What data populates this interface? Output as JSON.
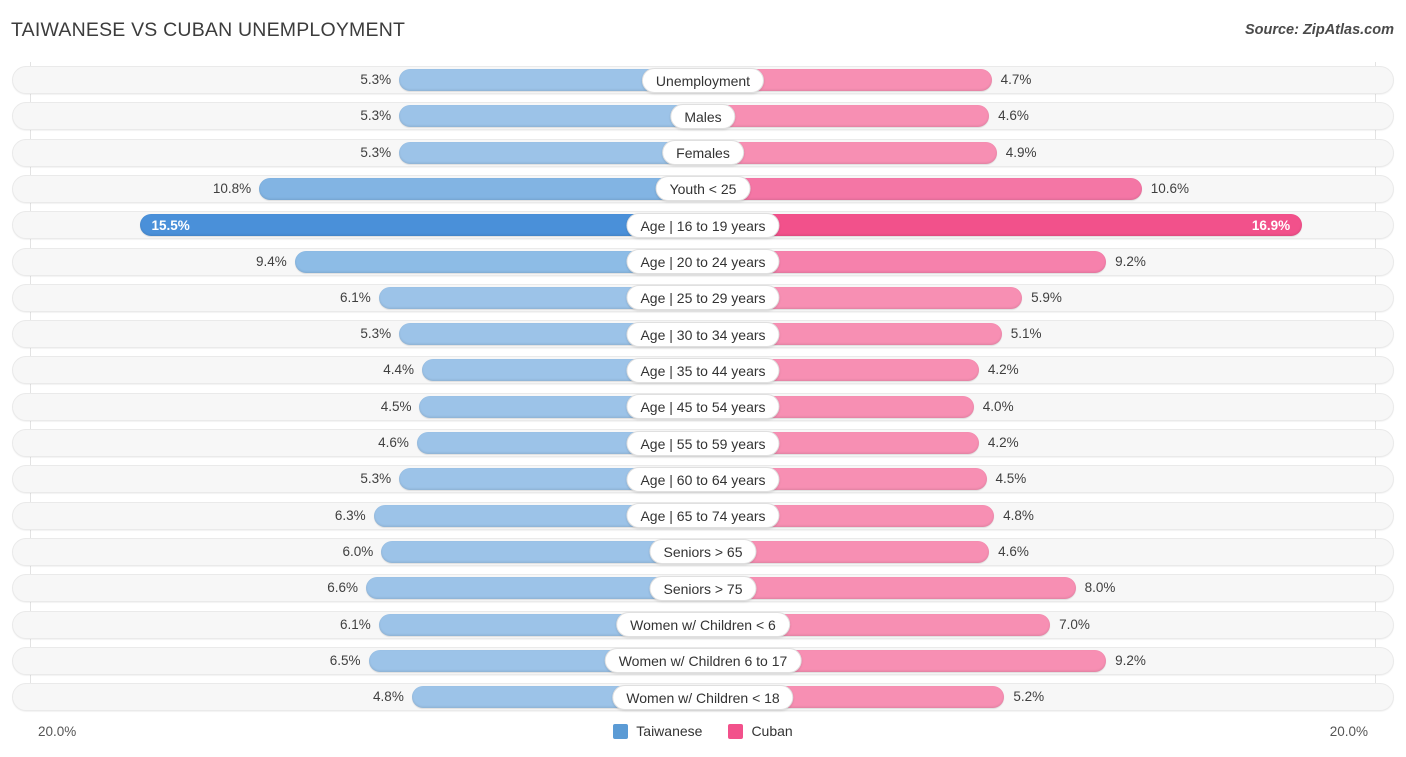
{
  "header": {
    "title": "TAIWANESE VS CUBAN UNEMPLOYMENT",
    "source": "Source: ZipAtlas.com"
  },
  "axis": {
    "left_label": "20.0%",
    "right_label": "20.0%"
  },
  "legend": {
    "items": [
      {
        "label": "Taiwanese",
        "color": "#5b9bd5"
      },
      {
        "label": "Cuban",
        "color": "#f2518b"
      }
    ]
  },
  "colors": {
    "taiwanese": "#9cc3e8",
    "taiwanese_max": "#4a90d9",
    "cuban": "#f78fb3",
    "cuban_max": "#f2518b",
    "track": "#f7f7f7",
    "gridline": "#e3e3e3"
  },
  "chart_data": {
    "type": "bar",
    "title": "TAIWANESE VS CUBAN UNEMPLOYMENT",
    "subtitle": "",
    "xlabel": "",
    "ylabel": "",
    "orientation": "horizontal-diverging",
    "axis_max_percent": 20.0,
    "xlim": [
      20.0,
      20.0
    ],
    "grid": true,
    "legend_position": "bottom-center",
    "categories": [
      "Unemployment",
      "Males",
      "Females",
      "Youth < 25",
      "Age | 16 to 19 years",
      "Age | 20 to 24 years",
      "Age | 25 to 29 years",
      "Age | 30 to 34 years",
      "Age | 35 to 44 years",
      "Age | 45 to 54 years",
      "Age | 55 to 59 years",
      "Age | 60 to 64 years",
      "Age | 65 to 74 years",
      "Seniors > 65",
      "Seniors > 75",
      "Women w/ Children < 6",
      "Women w/ Children 6 to 17",
      "Women w/ Children < 18"
    ],
    "series": [
      {
        "name": "Taiwanese",
        "side": "left",
        "color": "#9cc3e8",
        "values": [
          5.3,
          5.3,
          5.3,
          10.8,
          15.5,
          9.4,
          6.1,
          5.3,
          4.4,
          4.5,
          4.6,
          5.3,
          6.3,
          6.0,
          6.6,
          6.1,
          6.5,
          4.8
        ],
        "labels": [
          "5.3%",
          "5.3%",
          "5.3%",
          "10.8%",
          "15.5%",
          "9.4%",
          "6.1%",
          "5.3%",
          "4.4%",
          "4.5%",
          "4.6%",
          "5.3%",
          "6.3%",
          "6.0%",
          "6.6%",
          "6.1%",
          "6.5%",
          "4.8%"
        ]
      },
      {
        "name": "Cuban",
        "side": "right",
        "color": "#f78fb3",
        "values": [
          4.7,
          4.6,
          4.9,
          10.6,
          16.9,
          9.2,
          5.9,
          5.1,
          4.2,
          4.0,
          4.2,
          4.5,
          4.8,
          4.6,
          8.0,
          7.0,
          9.2,
          5.2
        ],
        "labels": [
          "4.7%",
          "4.6%",
          "4.9%",
          "10.6%",
          "16.9%",
          "9.2%",
          "5.9%",
          "5.1%",
          "4.2%",
          "4.0%",
          "4.2%",
          "4.5%",
          "4.8%",
          "4.6%",
          "8.0%",
          "7.0%",
          "9.2%",
          "5.2%"
        ]
      }
    ],
    "highlight_row_index": 4
  }
}
